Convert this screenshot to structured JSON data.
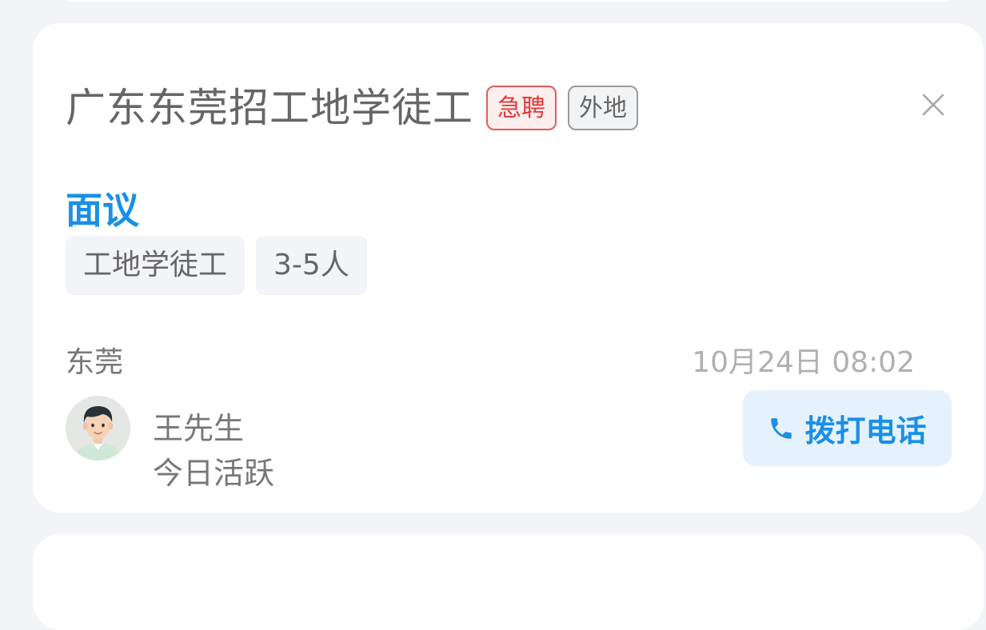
{
  "job": {
    "title": "广东东莞招工地学徒工",
    "tags": {
      "urgent": "急聘",
      "remote": "外地"
    },
    "salary": "面议",
    "chips": [
      "工地学徒工",
      "3-5人"
    ],
    "location": "东莞",
    "posted_time": "10月24日 08:02"
  },
  "contact": {
    "name": "王先生",
    "status": "今日活跃",
    "call_label": "拨打电话"
  },
  "icons": {
    "close": "close-icon",
    "phone": "phone-icon",
    "avatar": "avatar-illustration"
  },
  "colors": {
    "accent_blue": "#1a8fe8",
    "urgent_red": "#e03a3a",
    "page_background": "#f3f4f7"
  }
}
